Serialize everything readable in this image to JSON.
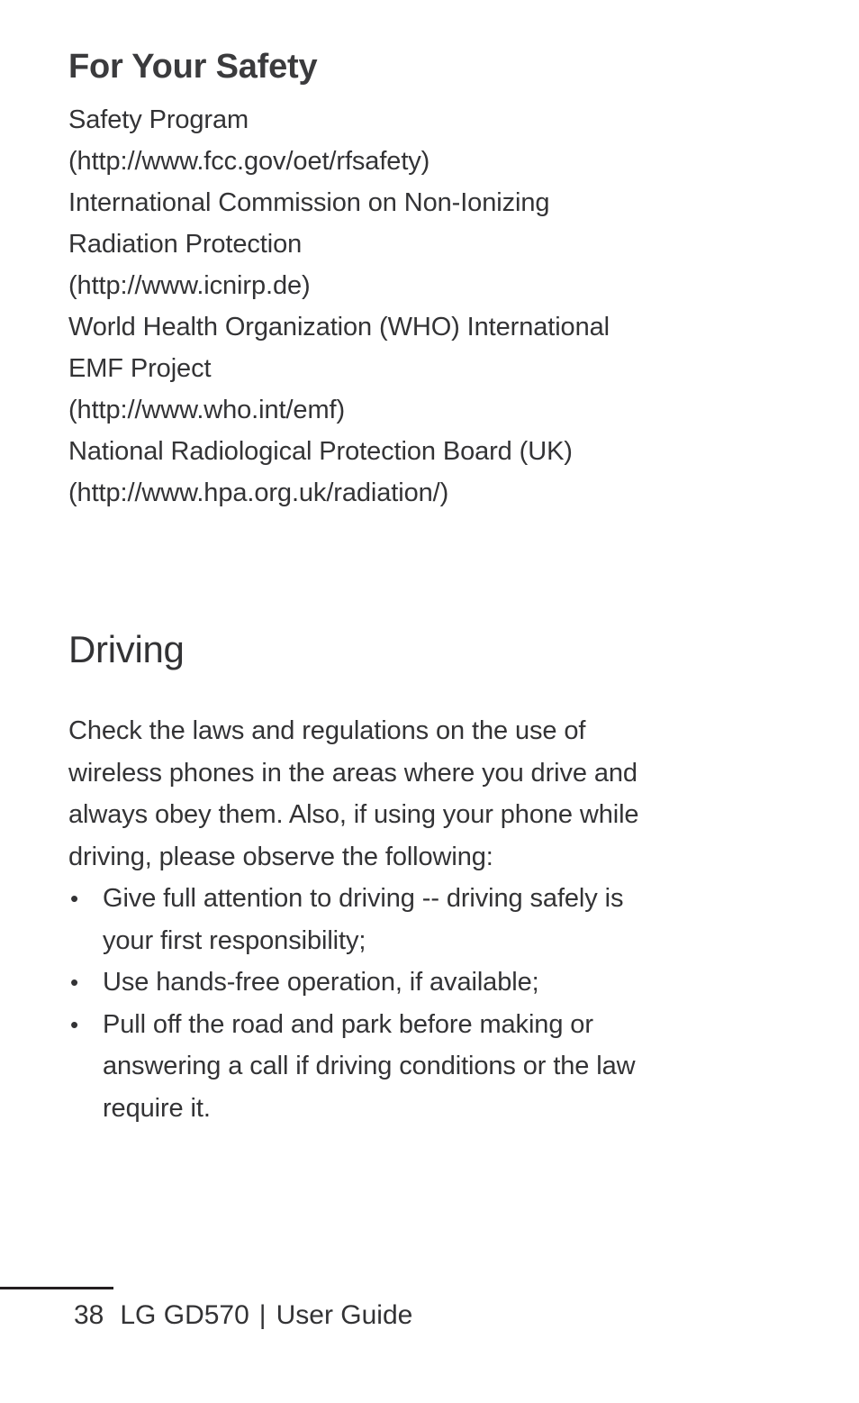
{
  "document": {
    "type": "user-guide-page",
    "page_number": "38",
    "background_color": "#ffffff",
    "text_color": "#333335",
    "heading_color": "#3b3b3d"
  },
  "sections": [
    {
      "id": "for-your-safety",
      "heading": "For Your Safety",
      "lines": [
        "Safety Program",
        "(http://www.fcc.gov/oet/rfsafety)",
        "International Commission on Non-Ionizing",
        "Radiation Protection",
        "(http://www.icnirp.de)",
        "World Health Organization (WHO) International",
        "EMF Project",
        "(http://www.who.int/emf)",
        "National Radiological Protection Board (UK)",
        "(http://www.hpa.org.uk/radiation/)"
      ]
    },
    {
      "id": "driving",
      "heading": "Driving",
      "paragraph_lines": [
        "Check the laws and regulations on the use of",
        "wireless phones in the areas where you drive and",
        "always obey them. Also, if using your phone while",
        "driving, please observe the following:"
      ],
      "bullet_marker": "•",
      "bullets": [
        {
          "lines": [
            "Give full attention to driving -- driving safely is",
            "your first responsibility;"
          ]
        },
        {
          "lines": [
            "Use hands-free operation, if available;"
          ]
        },
        {
          "lines": [
            "Pull off the road and park before making or",
            "answering a call if driving conditions or the law",
            "require it."
          ]
        }
      ]
    }
  ],
  "footer": {
    "page_number": "38",
    "product": "LG GD570",
    "separator": "|",
    "doc_type": "User Guide",
    "rule_color": "#231f20"
  }
}
